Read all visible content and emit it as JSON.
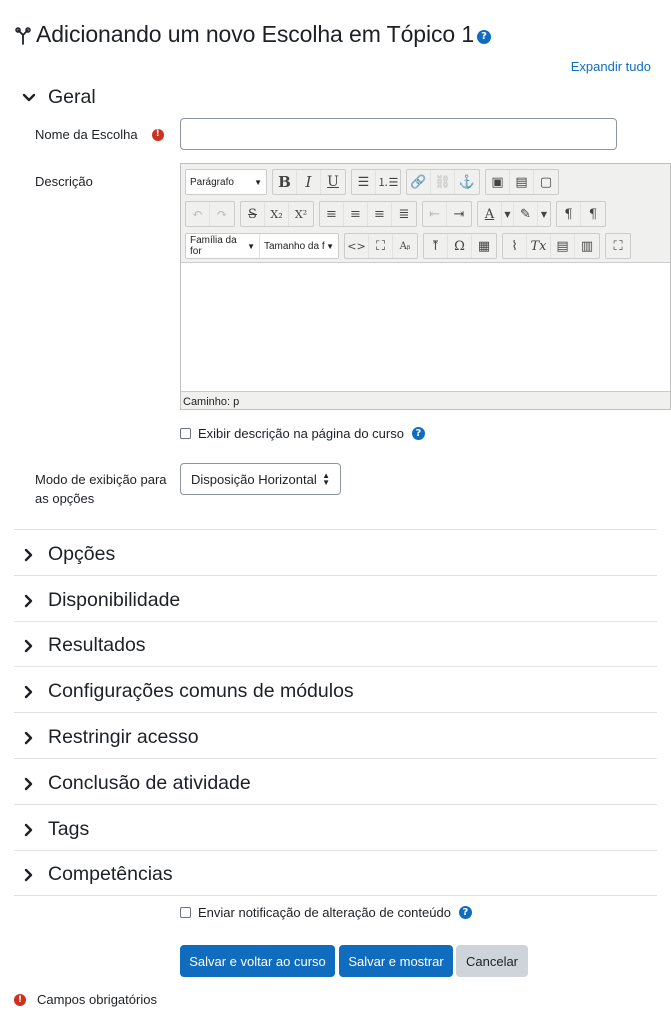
{
  "header": {
    "icon": "choice-icon",
    "title": "Adicionando um novo Escolha em Tópico 1",
    "help_glyph": "?"
  },
  "expand_all": "Expandir tudo",
  "general": {
    "title": "Geral",
    "name_label": "Nome da Escolha",
    "name_value": "",
    "required_glyph": "!",
    "description_label": "Descrição",
    "editor": {
      "paragraph_select": "Parágrafo",
      "font_family_select": "Família da for",
      "font_size_select": "Tamanho da f",
      "path_text": "Caminho: p",
      "content": ""
    },
    "show_description_label": "Exibir descrição na página do curso",
    "display_mode_label": "Modo de exibição para as opções",
    "display_mode_value": "Disposição Horizontal"
  },
  "sections": [
    {
      "label": "Opções"
    },
    {
      "label": "Disponibilidade"
    },
    {
      "label": "Resultados"
    },
    {
      "label": "Configurações comuns de módulos"
    },
    {
      "label": "Restringir acesso"
    },
    {
      "label": "Conclusão de atividade"
    },
    {
      "label": "Tags"
    },
    {
      "label": "Competências"
    }
  ],
  "notify_label": "Enviar notificação de alteração de conteúdo",
  "buttons": {
    "save_return": "Salvar e voltar ao curso",
    "save_display": "Salvar e mostrar",
    "cancel": "Cancelar"
  },
  "required_note": "Campos obrigatórios",
  "colors": {
    "primary": "#0f6cbf",
    "required": "#ca3120",
    "secondary": "#ced4da"
  }
}
